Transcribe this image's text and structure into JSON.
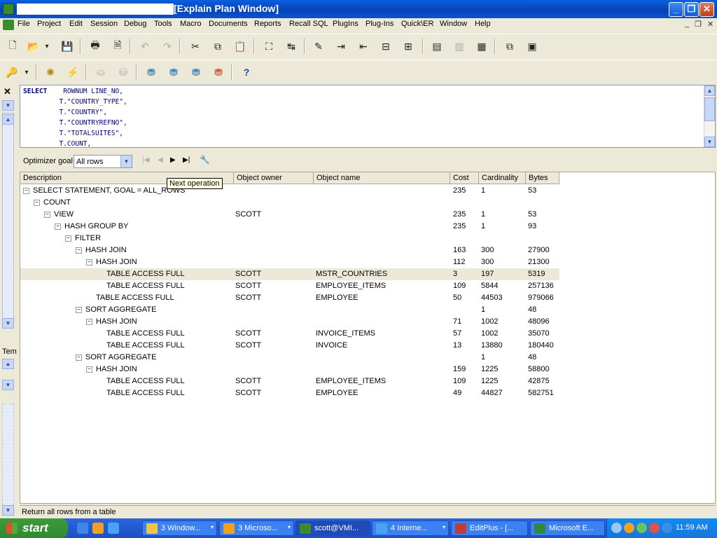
{
  "window": {
    "title": "[Explain Plan Window]",
    "min": "_",
    "max": "❐",
    "close": "✕"
  },
  "menu": {
    "items": [
      "File",
      "Project",
      "Edit",
      "Session",
      "Debug",
      "Tools",
      "Macro",
      "Documents",
      "Reports",
      "Recall SQL",
      "PlugIns",
      "Plug-Ins",
      "Quick\\ER",
      "Window",
      "Help"
    ],
    "mdi_min": "_",
    "mdi_restore": "❐",
    "mdi_close": "✕"
  },
  "toolbar1": {
    "icons": [
      "new-file-icon",
      "open-folder-icon",
      "dropdown-arrow-icon",
      "save-icon",
      "print-icon",
      "print-preview-icon",
      "undo-icon",
      "redo-icon",
      "cut-icon",
      "copy-icon",
      "paste-icon",
      "find-icon",
      "replace-icon",
      "edit-icon",
      "indent-icon",
      "outdent-icon",
      "comment-icon",
      "uncomment-icon",
      "execute-icon",
      "stop-icon",
      "step-icon",
      "window-cascade-icon",
      "window-tile-icon"
    ],
    "glyphs": [
      "🗋",
      "📂",
      "▾",
      "💾",
      "🖶",
      "🗎",
      "↶",
      "↷",
      "✂",
      "⧉",
      "📋",
      "⛶",
      "↹",
      "✎",
      "⇥",
      "⇤",
      "⊟",
      "⊞",
      "▤",
      "▥",
      "▦",
      "⧉",
      "▣"
    ]
  },
  "toolbar2": {
    "icons": [
      "key-icon",
      "dropdown-arrow-icon",
      "settings-gear-icon",
      "disconnect-icon",
      "commit-icon",
      "rollback-icon",
      "db-connect-icon",
      "sql-db-icon",
      "db-icon",
      "db-refresh-icon",
      "help-icon"
    ],
    "glyphs": [
      "🔑",
      "▾",
      "✺",
      "⚡",
      "⛀",
      "⛁",
      "⛃",
      "⛃",
      "⛃",
      "⛃",
      "?"
    ]
  },
  "left_dock": {
    "close": "✕",
    "dropdown": "▼",
    "up": "▲",
    "down": "▼",
    "temp_label": "Tem"
  },
  "sql": {
    "lines": [
      {
        "kw": "SELECT",
        "rest": "    ROWNUM LINE_NO,"
      },
      {
        "kw": "",
        "rest": "         T.\"COUNTRY_TYPE\","
      },
      {
        "kw": "",
        "rest": "         T.\"COUNTRY\","
      },
      {
        "kw": "",
        "rest": "         T.\"COUNTRYREFNO\","
      },
      {
        "kw": "",
        "rest": "         T.\"TOTALSUITES\","
      },
      {
        "kw": "",
        "rest": "         T.COUNT,"
      }
    ]
  },
  "optimizer": {
    "label": "Optimizer goal",
    "value": "All rows",
    "dropdown_glyph": "▼",
    "nav": [
      "|◀",
      "◀",
      "▶",
      "▶|"
    ],
    "wrench": "🔧"
  },
  "tooltip": "Next operation",
  "grid": {
    "columns": [
      "Description",
      "Object owner",
      "Object name",
      "Cost",
      "Cardinality",
      "Bytes"
    ],
    "rows": [
      {
        "indent": 0,
        "expander": "⊟",
        "desc": "SELECT STATEMENT, GOAL = ALL_ROWS",
        "owner": "",
        "name": "",
        "cost": "235",
        "card": "1",
        "bytes": "53"
      },
      {
        "indent": 1,
        "expander": "⊟",
        "desc": "COUNT",
        "owner": "",
        "name": "",
        "cost": "",
        "card": "",
        "bytes": ""
      },
      {
        "indent": 2,
        "expander": "⊟",
        "desc": "VIEW",
        "owner": "SCOTT",
        "name": "",
        "cost": "235",
        "card": "1",
        "bytes": "53"
      },
      {
        "indent": 3,
        "expander": "⊟",
        "desc": "HASH GROUP BY",
        "owner": "",
        "name": "",
        "cost": "235",
        "card": "1",
        "bytes": "93"
      },
      {
        "indent": 4,
        "expander": "⊟",
        "desc": "FILTER",
        "owner": "",
        "name": "",
        "cost": "",
        "card": "",
        "bytes": ""
      },
      {
        "indent": 5,
        "expander": "⊟",
        "desc": "HASH JOIN",
        "owner": "",
        "name": "",
        "cost": "163",
        "card": "300",
        "bytes": "27900"
      },
      {
        "indent": 6,
        "expander": "⊟",
        "desc": "HASH JOIN",
        "owner": "",
        "name": "",
        "cost": "112",
        "card": "300",
        "bytes": "21300"
      },
      {
        "indent": 7,
        "expander": "",
        "desc": "TABLE ACCESS FULL",
        "owner": "SCOTT",
        "name": "MSTR_COUNTRIES",
        "cost": "3",
        "card": "197",
        "bytes": "5319",
        "selected": true
      },
      {
        "indent": 7,
        "expander": "",
        "desc": "TABLE ACCESS FULL",
        "owner": "SCOTT",
        "name": "EMPLOYEE_ITEMS",
        "cost": "109",
        "card": "5844",
        "bytes": "257136"
      },
      {
        "indent": 6,
        "expander": "",
        "desc": "TABLE ACCESS FULL",
        "owner": "SCOTT",
        "name": "EMPLOYEE",
        "cost": "50",
        "card": "44503",
        "bytes": "979066"
      },
      {
        "indent": 5,
        "expander": "⊟",
        "desc": "SORT AGGREGATE",
        "owner": "",
        "name": "",
        "cost": "",
        "card": "1",
        "bytes": "48"
      },
      {
        "indent": 6,
        "expander": "⊟",
        "desc": "HASH JOIN",
        "owner": "",
        "name": "",
        "cost": "71",
        "card": "1002",
        "bytes": "48096"
      },
      {
        "indent": 7,
        "expander": "",
        "desc": "TABLE ACCESS FULL",
        "owner": "SCOTT",
        "name": "INVOICE_ITEMS",
        "cost": "57",
        "card": "1002",
        "bytes": "35070"
      },
      {
        "indent": 7,
        "expander": "",
        "desc": "TABLE ACCESS FULL",
        "owner": "SCOTT",
        "name": "INVOICE",
        "cost": "13",
        "card": "13880",
        "bytes": "180440"
      },
      {
        "indent": 5,
        "expander": "⊟",
        "desc": "SORT AGGREGATE",
        "owner": "",
        "name": "",
        "cost": "",
        "card": "1",
        "bytes": "48"
      },
      {
        "indent": 6,
        "expander": "⊟",
        "desc": "HASH JOIN",
        "owner": "",
        "name": "",
        "cost": "159",
        "card": "1225",
        "bytes": "58800"
      },
      {
        "indent": 7,
        "expander": "",
        "desc": "TABLE ACCESS FULL",
        "owner": "SCOTT",
        "name": "EMPLOYEE_ITEMS",
        "cost": "109",
        "card": "1225",
        "bytes": "42875"
      },
      {
        "indent": 7,
        "expander": "",
        "desc": "TABLE ACCESS FULL",
        "owner": "SCOTT",
        "name": "EMPLOYEE",
        "cost": "49",
        "card": "44827",
        "bytes": "582751"
      }
    ]
  },
  "status": "Return all rows from a table",
  "taskbar": {
    "start": "start",
    "tasks": [
      {
        "label": "3 Window...",
        "color": "#f2c44a",
        "arrow": "▾"
      },
      {
        "label": "3 Microso...",
        "color": "#f0a21e",
        "arrow": "▾"
      },
      {
        "label": "scott@VMI...",
        "color": "#3a8a2e",
        "arrow": "",
        "active": true
      },
      {
        "label": "4 Interne...",
        "color": "#4aa3f0",
        "arrow": "▾"
      },
      {
        "label": "EditPlus - [...",
        "color": "#c23b3b",
        "arrow": ""
      },
      {
        "label": "Microsoft E...",
        "color": "#2f8a3a",
        "arrow": ""
      }
    ],
    "clock": "11:59 AM"
  }
}
